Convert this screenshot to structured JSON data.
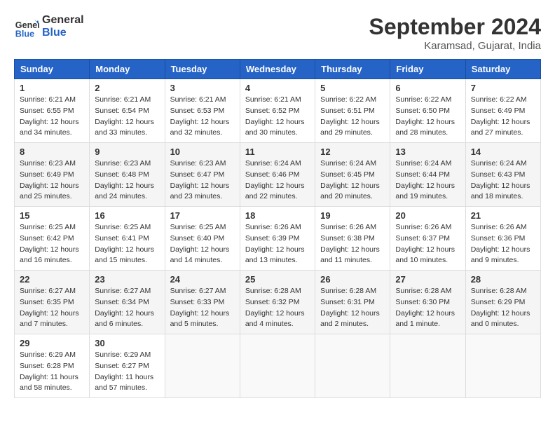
{
  "header": {
    "logo_line1": "General",
    "logo_line2": "Blue",
    "month_title": "September 2024",
    "location": "Karamsad, Gujarat, India"
  },
  "weekdays": [
    "Sunday",
    "Monday",
    "Tuesday",
    "Wednesday",
    "Thursday",
    "Friday",
    "Saturday"
  ],
  "weeks": [
    [
      {
        "day": "1",
        "sunrise": "Sunrise: 6:21 AM",
        "sunset": "Sunset: 6:55 PM",
        "daylight": "Daylight: 12 hours and 34 minutes."
      },
      {
        "day": "2",
        "sunrise": "Sunrise: 6:21 AM",
        "sunset": "Sunset: 6:54 PM",
        "daylight": "Daylight: 12 hours and 33 minutes."
      },
      {
        "day": "3",
        "sunrise": "Sunrise: 6:21 AM",
        "sunset": "Sunset: 6:53 PM",
        "daylight": "Daylight: 12 hours and 32 minutes."
      },
      {
        "day": "4",
        "sunrise": "Sunrise: 6:21 AM",
        "sunset": "Sunset: 6:52 PM",
        "daylight": "Daylight: 12 hours and 30 minutes."
      },
      {
        "day": "5",
        "sunrise": "Sunrise: 6:22 AM",
        "sunset": "Sunset: 6:51 PM",
        "daylight": "Daylight: 12 hours and 29 minutes."
      },
      {
        "day": "6",
        "sunrise": "Sunrise: 6:22 AM",
        "sunset": "Sunset: 6:50 PM",
        "daylight": "Daylight: 12 hours and 28 minutes."
      },
      {
        "day": "7",
        "sunrise": "Sunrise: 6:22 AM",
        "sunset": "Sunset: 6:49 PM",
        "daylight": "Daylight: 12 hours and 27 minutes."
      }
    ],
    [
      {
        "day": "8",
        "sunrise": "Sunrise: 6:23 AM",
        "sunset": "Sunset: 6:49 PM",
        "daylight": "Daylight: 12 hours and 25 minutes."
      },
      {
        "day": "9",
        "sunrise": "Sunrise: 6:23 AM",
        "sunset": "Sunset: 6:48 PM",
        "daylight": "Daylight: 12 hours and 24 minutes."
      },
      {
        "day": "10",
        "sunrise": "Sunrise: 6:23 AM",
        "sunset": "Sunset: 6:47 PM",
        "daylight": "Daylight: 12 hours and 23 minutes."
      },
      {
        "day": "11",
        "sunrise": "Sunrise: 6:24 AM",
        "sunset": "Sunset: 6:46 PM",
        "daylight": "Daylight: 12 hours and 22 minutes."
      },
      {
        "day": "12",
        "sunrise": "Sunrise: 6:24 AM",
        "sunset": "Sunset: 6:45 PM",
        "daylight": "Daylight: 12 hours and 20 minutes."
      },
      {
        "day": "13",
        "sunrise": "Sunrise: 6:24 AM",
        "sunset": "Sunset: 6:44 PM",
        "daylight": "Daylight: 12 hours and 19 minutes."
      },
      {
        "day": "14",
        "sunrise": "Sunrise: 6:24 AM",
        "sunset": "Sunset: 6:43 PM",
        "daylight": "Daylight: 12 hours and 18 minutes."
      }
    ],
    [
      {
        "day": "15",
        "sunrise": "Sunrise: 6:25 AM",
        "sunset": "Sunset: 6:42 PM",
        "daylight": "Daylight: 12 hours and 16 minutes."
      },
      {
        "day": "16",
        "sunrise": "Sunrise: 6:25 AM",
        "sunset": "Sunset: 6:41 PM",
        "daylight": "Daylight: 12 hours and 15 minutes."
      },
      {
        "day": "17",
        "sunrise": "Sunrise: 6:25 AM",
        "sunset": "Sunset: 6:40 PM",
        "daylight": "Daylight: 12 hours and 14 minutes."
      },
      {
        "day": "18",
        "sunrise": "Sunrise: 6:26 AM",
        "sunset": "Sunset: 6:39 PM",
        "daylight": "Daylight: 12 hours and 13 minutes."
      },
      {
        "day": "19",
        "sunrise": "Sunrise: 6:26 AM",
        "sunset": "Sunset: 6:38 PM",
        "daylight": "Daylight: 12 hours and 11 minutes."
      },
      {
        "day": "20",
        "sunrise": "Sunrise: 6:26 AM",
        "sunset": "Sunset: 6:37 PM",
        "daylight": "Daylight: 12 hours and 10 minutes."
      },
      {
        "day": "21",
        "sunrise": "Sunrise: 6:26 AM",
        "sunset": "Sunset: 6:36 PM",
        "daylight": "Daylight: 12 hours and 9 minutes."
      }
    ],
    [
      {
        "day": "22",
        "sunrise": "Sunrise: 6:27 AM",
        "sunset": "Sunset: 6:35 PM",
        "daylight": "Daylight: 12 hours and 7 minutes."
      },
      {
        "day": "23",
        "sunrise": "Sunrise: 6:27 AM",
        "sunset": "Sunset: 6:34 PM",
        "daylight": "Daylight: 12 hours and 6 minutes."
      },
      {
        "day": "24",
        "sunrise": "Sunrise: 6:27 AM",
        "sunset": "Sunset: 6:33 PM",
        "daylight": "Daylight: 12 hours and 5 minutes."
      },
      {
        "day": "25",
        "sunrise": "Sunrise: 6:28 AM",
        "sunset": "Sunset: 6:32 PM",
        "daylight": "Daylight: 12 hours and 4 minutes."
      },
      {
        "day": "26",
        "sunrise": "Sunrise: 6:28 AM",
        "sunset": "Sunset: 6:31 PM",
        "daylight": "Daylight: 12 hours and 2 minutes."
      },
      {
        "day": "27",
        "sunrise": "Sunrise: 6:28 AM",
        "sunset": "Sunset: 6:30 PM",
        "daylight": "Daylight: 12 hours and 1 minute."
      },
      {
        "day": "28",
        "sunrise": "Sunrise: 6:28 AM",
        "sunset": "Sunset: 6:29 PM",
        "daylight": "Daylight: 12 hours and 0 minutes."
      }
    ],
    [
      {
        "day": "29",
        "sunrise": "Sunrise: 6:29 AM",
        "sunset": "Sunset: 6:28 PM",
        "daylight": "Daylight: 11 hours and 58 minutes."
      },
      {
        "day": "30",
        "sunrise": "Sunrise: 6:29 AM",
        "sunset": "Sunset: 6:27 PM",
        "daylight": "Daylight: 11 hours and 57 minutes."
      },
      null,
      null,
      null,
      null,
      null
    ]
  ]
}
